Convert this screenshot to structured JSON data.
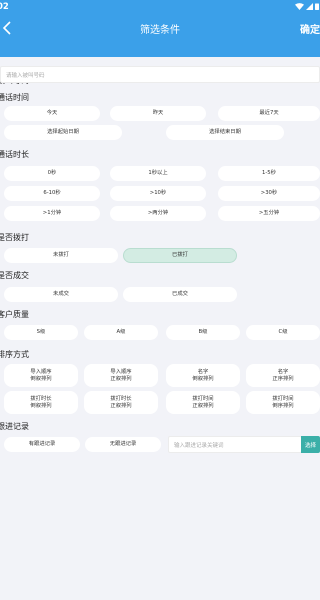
{
  "status": {
    "time": "02"
  },
  "header": {
    "title": "筛选条件",
    "confirm_label": "确定"
  },
  "sections": {
    "call_number": {
      "title": "被叫号码",
      "placeholder": "请输入被叫号码"
    },
    "call_time": {
      "title": "通话时间",
      "options": [
        "今天",
        "昨天",
        "最近7天"
      ],
      "start_date": "选择起始日期",
      "end_date": "选择结束日期"
    },
    "duration": {
      "title": "通话时长",
      "rows": [
        [
          "0秒",
          "1秒以上",
          "1-5秒"
        ],
        [
          "6-10秒",
          ">10秒",
          ">30秒"
        ],
        [
          ">1分钟",
          ">两分钟",
          ">五分钟"
        ]
      ]
    },
    "dialed": {
      "title": "是否拨打",
      "options": [
        "未拨打",
        "已拨打"
      ],
      "selected": "已拨打"
    },
    "deal": {
      "title": "是否成交",
      "options": [
        "未成交",
        "已成交"
      ]
    },
    "quality": {
      "title": "客户质量",
      "options": [
        "S级",
        "A级",
        "B级",
        "C级"
      ]
    },
    "sort": {
      "title": "排序方式",
      "rows": [
        [
          [
            "导入顺序",
            "倒叙排列"
          ],
          [
            "导入顺序",
            "正叙排列"
          ],
          [
            "名字",
            "倒叙排列"
          ],
          [
            "名字",
            "正序排列"
          ]
        ],
        [
          [
            "拨打时长",
            "倒叙排列"
          ],
          [
            "拨打时长",
            "正叙排列"
          ],
          [
            "拨打时间",
            "正叙排列"
          ],
          [
            "拨打时间",
            "倒序排列"
          ]
        ]
      ]
    },
    "followup": {
      "title": "跟进记录",
      "options": [
        "有跟进记录",
        "无跟进记录"
      ],
      "placeholder": "输入跟进记录关键词",
      "select_label": "选择"
    }
  }
}
